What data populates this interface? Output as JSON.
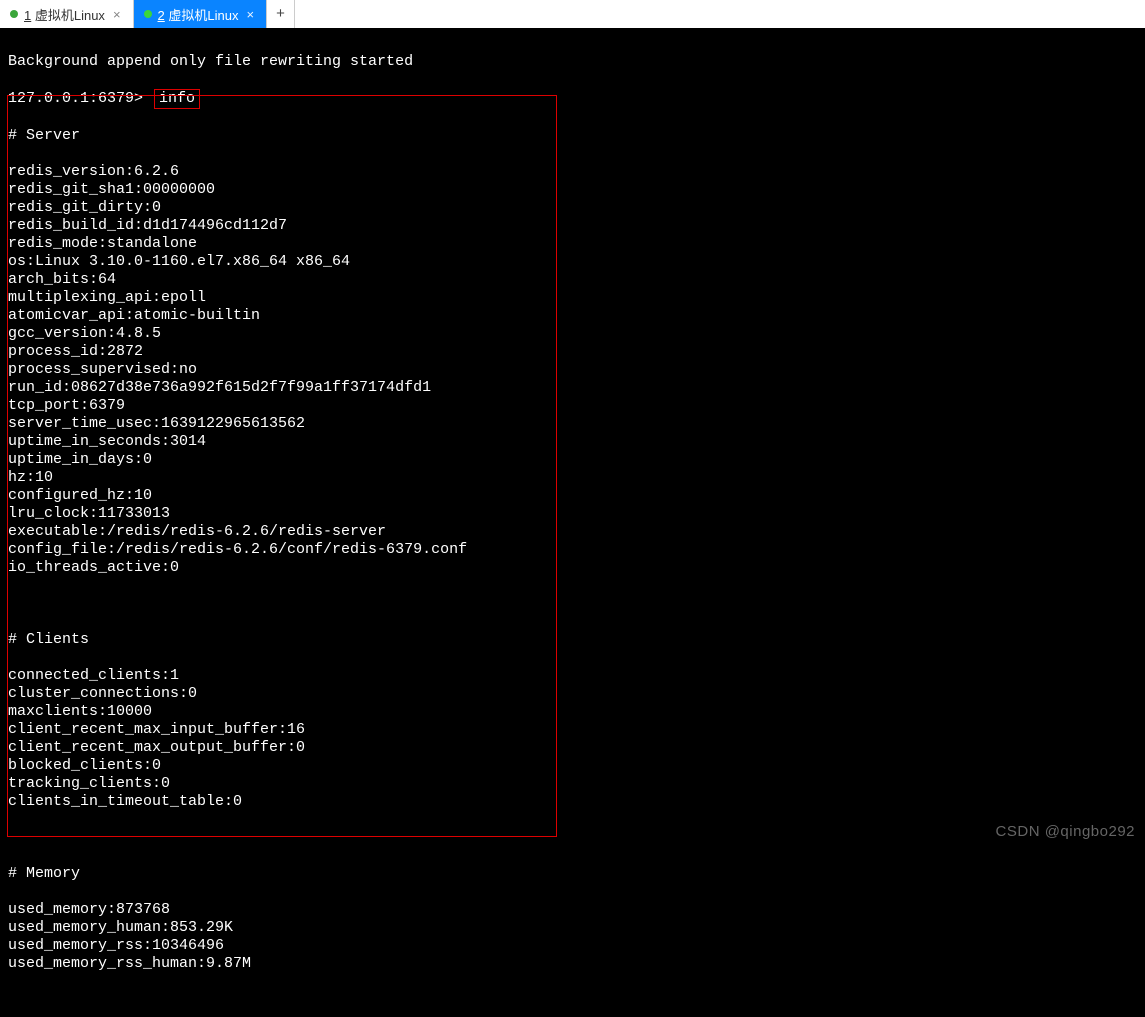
{
  "tabs": [
    {
      "label": "1 虚拟机Linux",
      "accel": "1",
      "active": false
    },
    {
      "label": "2 虚拟机Linux",
      "accel": "2",
      "active": true
    }
  ],
  "newtab_label": "+",
  "terminal": {
    "pre_line": "Background append only file rewriting started",
    "prompt": "127.0.0.1:6379>",
    "command": "info",
    "header_server": "# Server",
    "server_lines": [
      "redis_version:6.2.6",
      "redis_git_sha1:00000000",
      "redis_git_dirty:0",
      "redis_build_id:d1d174496cd112d7",
      "redis_mode:standalone",
      "os:Linux 3.10.0-1160.el7.x86_64 x86_64",
      "arch_bits:64",
      "multiplexing_api:epoll",
      "atomicvar_api:atomic-builtin",
      "gcc_version:4.8.5",
      "process_id:2872",
      "process_supervised:no",
      "run_id:08627d38e736a992f615d2f7f99a1ff37174dfd1",
      "tcp_port:6379",
      "server_time_usec:1639122965613562",
      "uptime_in_seconds:3014",
      "uptime_in_days:0",
      "hz:10",
      "configured_hz:10",
      "lru_clock:11733013",
      "executable:/redis/redis-6.2.6/redis-server",
      "config_file:/redis/redis-6.2.6/conf/redis-6379.conf",
      "io_threads_active:0"
    ],
    "header_clients": "# Clients",
    "clients_lines": [
      "connected_clients:1",
      "cluster_connections:0",
      "maxclients:10000",
      "client_recent_max_input_buffer:16",
      "client_recent_max_output_buffer:0",
      "blocked_clients:0",
      "tracking_clients:0",
      "clients_in_timeout_table:0"
    ],
    "header_memory": "# Memory",
    "memory_lines": [
      "used_memory:873768",
      "used_memory_human:853.29K",
      "used_memory_rss:10346496",
      "used_memory_rss_human:9.87M"
    ]
  },
  "watermark": "CSDN @qingbo292"
}
